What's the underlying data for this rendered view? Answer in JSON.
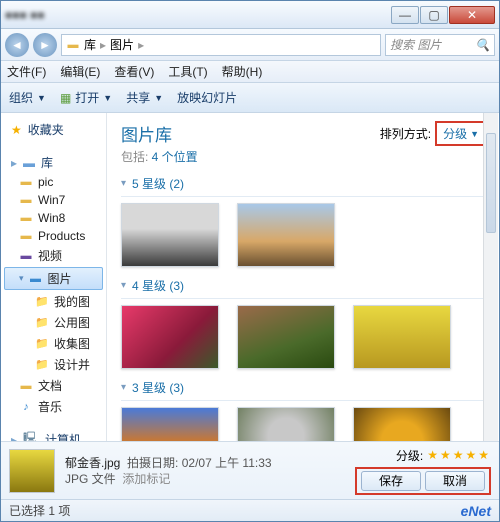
{
  "breadcrumb": {
    "root": "库",
    "current": "图片"
  },
  "search": {
    "placeholder": "搜索 图片"
  },
  "menu": {
    "file": "文件(F)",
    "edit": "编辑(E)",
    "view": "查看(V)",
    "tools": "工具(T)",
    "help": "帮助(H)"
  },
  "toolbar": {
    "organize": "组织",
    "open": "打开",
    "share": "共享",
    "slideshow": "放映幻灯片"
  },
  "sidebar": {
    "favorites": "收藏夹",
    "libraries": "库",
    "items": [
      {
        "label": "pic"
      },
      {
        "label": "Win7"
      },
      {
        "label": "Win8"
      },
      {
        "label": "Products"
      },
      {
        "label": "视频"
      },
      {
        "label": "图片"
      },
      {
        "label": "我的图"
      },
      {
        "label": "公用图"
      },
      {
        "label": "收集图"
      },
      {
        "label": "设计并"
      }
    ],
    "documents": "文档",
    "music": "音乐",
    "computer": "计算机"
  },
  "header": {
    "title": "图片库",
    "subtitle_prefix": "包括: ",
    "subtitle_link": "4 个位置",
    "sort_label": "排列方式:",
    "sort_value": "分级"
  },
  "groups": [
    {
      "title": "5 星级 (2)",
      "thumbs": 2
    },
    {
      "title": "4 星级 (3)",
      "thumbs": 3
    },
    {
      "title": "3 星级 (3)",
      "thumbs": 3
    }
  ],
  "details": {
    "filename": "郁金香.jpg",
    "date_label": "拍摄日期:",
    "date_value": "02/07 上午 11:33",
    "type": "JPG 文件",
    "tags_label": "添加标记",
    "rating_label": "分级:",
    "save": "保存",
    "cancel": "取消"
  },
  "status": {
    "selection": "已选择 1 项",
    "brand": "eNet"
  }
}
